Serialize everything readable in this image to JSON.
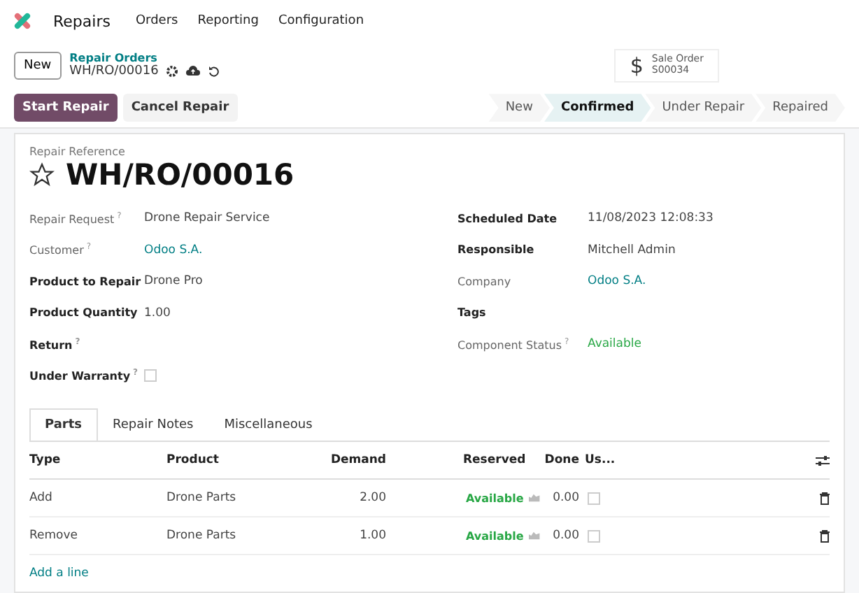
{
  "navbar": {
    "app": "Repairs",
    "menus": [
      "Orders",
      "Reporting",
      "Configuration"
    ]
  },
  "control_panel": {
    "new_button": "New",
    "breadcrumb": "Repair Orders",
    "record": "WH/RO/00016",
    "smart_button": {
      "icon": "$",
      "label": "Sale Order",
      "value": "S00034"
    }
  },
  "actions": [
    {
      "label": "Start Repair",
      "kind": "primary"
    },
    {
      "label": "Cancel Repair",
      "kind": "secondary"
    }
  ],
  "stages": [
    {
      "label": "New",
      "selected": false
    },
    {
      "label": "Confirmed",
      "selected": true
    },
    {
      "label": "Under Repair",
      "selected": false
    },
    {
      "label": "Repaired",
      "selected": false
    }
  ],
  "form": {
    "reference_label": "Repair Reference",
    "title": "WH/RO/00016",
    "starred": false,
    "left_fields": [
      {
        "label": "Repair Request",
        "help": "?",
        "bold": false,
        "value": "Drone Repair Service",
        "kind": "text"
      },
      {
        "label": "Customer",
        "help": "?",
        "bold": false,
        "value": "Odoo S.A.",
        "kind": "link"
      },
      {
        "label": "Product to Repair",
        "bold": true,
        "value": "Drone Pro",
        "kind": "text"
      },
      {
        "label": "Product Quantity",
        "bold": true,
        "value": "1.00",
        "kind": "text"
      },
      {
        "label": "Return",
        "help": "?",
        "bold": true,
        "kind": "text"
      },
      {
        "label": "Under Warranty",
        "help": "?",
        "bold": true,
        "kind": "checkbox",
        "checked": false
      }
    ],
    "right_fields": [
      {
        "label": "Scheduled Date",
        "bold": true,
        "value": "11/08/2023 12:08:33",
        "kind": "text"
      },
      {
        "label": "Responsible",
        "bold": true,
        "value": "Mitchell Admin",
        "kind": "text"
      },
      {
        "label": "Company",
        "bold": false,
        "value": "Odoo S.A.",
        "kind": "link"
      },
      {
        "label": "Tags",
        "bold": true,
        "kind": "text"
      },
      {
        "label": "Component Status",
        "help": "?",
        "bold": false,
        "value": "Available",
        "kind": "status"
      }
    ]
  },
  "tabs": [
    {
      "label": "Parts",
      "selected": true
    },
    {
      "label": "Repair Notes",
      "selected": false
    },
    {
      "label": "Miscellaneous",
      "selected": false
    }
  ],
  "table": {
    "columns": [
      "Type",
      "Product",
      "Demand",
      "Reserved",
      "Done",
      "Us..."
    ],
    "rows": [
      {
        "type": "Add",
        "product": "Drone Parts",
        "demand": "2.00",
        "reserved": "Available",
        "done": "0.00",
        "used": false
      },
      {
        "type": "Remove",
        "product": "Drone Parts",
        "demand": "1.00",
        "reserved": "Available",
        "done": "0.00",
        "used": false
      }
    ],
    "add_line": "Add a line"
  }
}
